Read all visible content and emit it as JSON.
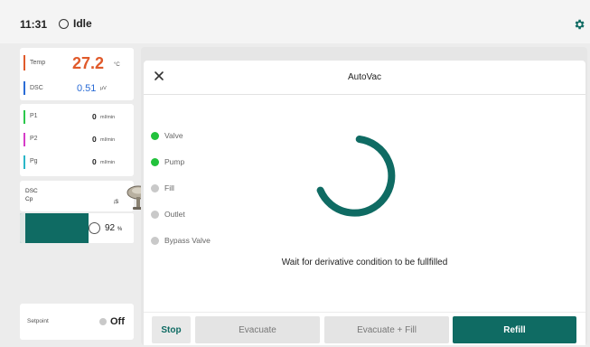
{
  "header": {
    "time": "11:31",
    "status": "Idle",
    "settings_icon": "gear-icon"
  },
  "colors": {
    "accent": "#0f6b63",
    "temp": "#e05a2b",
    "dsc": "#2a6cd6",
    "p1": "#2cc84c",
    "p2": "#d63cc8",
    "pg": "#2ab6c8",
    "active": "#22c23c",
    "inactive": "#c9c9c9"
  },
  "sidebar": {
    "temp": {
      "label": "Temp",
      "value": "27.2",
      "unit": "°C"
    },
    "dsc": {
      "label": "DSC",
      "value": "0.51",
      "unit": "μV"
    },
    "p1": {
      "label": "P1",
      "value": "0",
      "unit": "ml/min"
    },
    "p2": {
      "label": "P2",
      "value": "0",
      "unit": "ml/min"
    },
    "pg": {
      "label": "Pg",
      "value": "0",
      "unit": "ml/min"
    },
    "dsc_cp": {
      "line1": "DSC",
      "line2": "Cp",
      "indicator": "ᵢs",
      "image_icon": "pump-icon"
    },
    "progress": {
      "value": "92",
      "unit": "%",
      "fraction": 0.6
    },
    "setpoint": {
      "label": "Setpoint",
      "value": "Off"
    }
  },
  "dialog": {
    "title": "AutoVac",
    "close_icon": "close-icon",
    "indicators": [
      {
        "label": "Valve",
        "active": true
      },
      {
        "label": "Pump",
        "active": true
      },
      {
        "label": "Fill",
        "active": false
      },
      {
        "label": "Outlet",
        "active": false
      },
      {
        "label": "Bypass Valve",
        "active": false
      }
    ],
    "message": "Wait for derivative condition to be fullfilled",
    "buttons": {
      "stop": "Stop",
      "evacuate": "Evacuate",
      "evacuate_fill": "Evacuate + Fill",
      "refill": "Refill"
    }
  }
}
